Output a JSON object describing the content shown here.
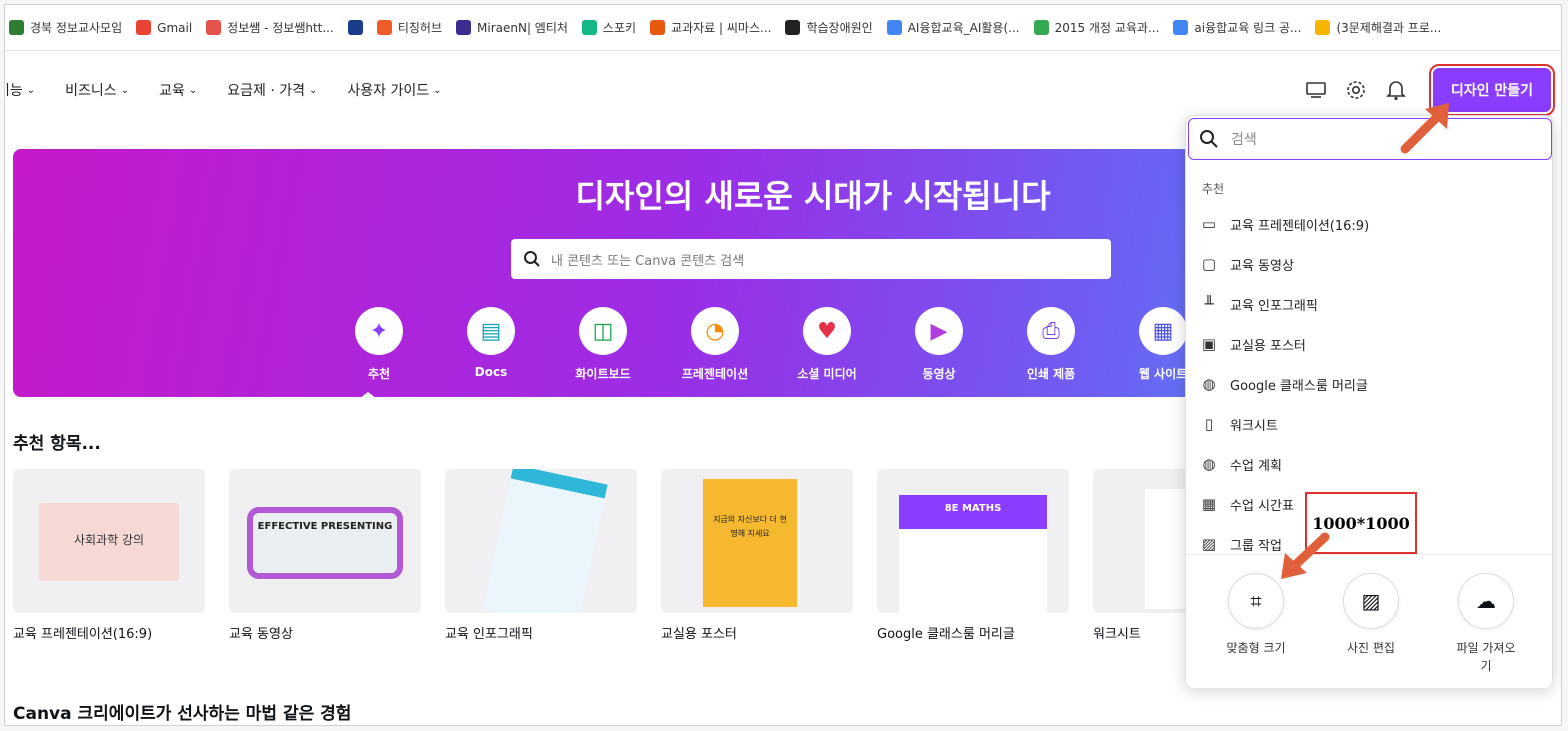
{
  "bookmarks": [
    {
      "label": "경북 정보교사모임",
      "color": "#2e7d32"
    },
    {
      "label": "Gmail",
      "color": "#ea4335"
    },
    {
      "label": "정보쌤 - 정보쌤htt...",
      "color": "#e5544b"
    },
    {
      "label": "",
      "color": "#1a3c8c"
    },
    {
      "label": "티칭허브",
      "color": "#f05a28"
    },
    {
      "label": "MiraenN| 엠티처",
      "color": "#3c2d8f"
    },
    {
      "label": "스포키",
      "color": "#12b886"
    },
    {
      "label": "교과자료 | 씨마스...",
      "color": "#e8590c"
    },
    {
      "label": "학습장애원인",
      "color": "#222222"
    },
    {
      "label": "AI융합교육_AI활용(...",
      "color": "#4285f4"
    },
    {
      "label": "2015 개정 교육과...",
      "color": "#34a853"
    },
    {
      "label": "ai융합교육 링크 공...",
      "color": "#4285f4"
    },
    {
      "label": "(3문제해결과 프로...",
      "color": "#f4b400"
    }
  ],
  "nav": {
    "items": [
      "기능",
      "비즈니스",
      "교육",
      "요금제 · 가격",
      "사용자 가이드"
    ],
    "create_label": "디자인 만들기"
  },
  "hero": {
    "title": "디자인의 새로운 시대가 시작됩니다",
    "search_placeholder": "내 콘텐츠 또는 Canva 콘텐츠 검색",
    "categories": [
      {
        "label": "추천",
        "icon": "sparkle-icon",
        "glyph": "✦",
        "color": "#8b3dff"
      },
      {
        "label": "Docs",
        "icon": "docs-icon",
        "glyph": "▤",
        "color": "#13a3b5"
      },
      {
        "label": "화이트보드",
        "icon": "whiteboard-icon",
        "glyph": "◫",
        "color": "#1aa34a"
      },
      {
        "label": "프레젠테이션",
        "icon": "presentation-icon",
        "glyph": "◔",
        "color": "#ff8a00"
      },
      {
        "label": "소셜 미디어",
        "icon": "heart-icon",
        "glyph": "♥",
        "color": "#e5304a"
      },
      {
        "label": "동영상",
        "icon": "video-icon",
        "glyph": "▶",
        "color": "#b13ae0"
      },
      {
        "label": "인쇄 제품",
        "icon": "print-icon",
        "glyph": "⎙",
        "color": "#7a3de0"
      },
      {
        "label": "웹 사이트",
        "icon": "website-icon",
        "glyph": "▦",
        "color": "#4f53e8"
      }
    ]
  },
  "recommend": {
    "title": "추천 항목...",
    "cards": [
      {
        "label": "교육 프레젠테이션(16:9)",
        "thumb_text": "사회과학 강의"
      },
      {
        "label": "교육 동영상",
        "thumb_text": "EFFECTIVE PRESENTING"
      },
      {
        "label": "교육 인포그래픽",
        "thumb_text": ""
      },
      {
        "label": "교실용 포스터",
        "thumb_text": "지금의 자신보다 더 현명해 지세요"
      },
      {
        "label": "Google 클래스룸 머리글",
        "thumb_text": "8E MATHS"
      },
      {
        "label": "워크시트",
        "thumb_text": ""
      }
    ]
  },
  "section2_title": "Canva 크리에이트가 선사하는 마법 같은 경험",
  "dropdown": {
    "search_placeholder": "검색",
    "heading": "추천",
    "items": [
      {
        "label": "교육 프레젠테이션(16:9)",
        "icon": "presentation-icon",
        "glyph": "▭"
      },
      {
        "label": "교육 동영상",
        "icon": "video-camera-icon",
        "glyph": "▢"
      },
      {
        "label": "교육 인포그래픽",
        "icon": "bar-chart-icon",
        "glyph": "╨"
      },
      {
        "label": "교실용 포스터",
        "icon": "poster-icon",
        "glyph": "▣"
      },
      {
        "label": "Google 클래스룸 머리글",
        "icon": "apple-icon",
        "glyph": "◍"
      },
      {
        "label": "워크시트",
        "icon": "document-icon",
        "glyph": "▯"
      },
      {
        "label": "수업 계획",
        "icon": "apple-icon",
        "glyph": "◍"
      },
      {
        "label": "수업 시간표",
        "icon": "calendar-icon",
        "glyph": "▦"
      },
      {
        "label": "그룹 작업",
        "icon": "image-icon",
        "glyph": "▨"
      }
    ],
    "actions": [
      {
        "label": "맞춤형 크기",
        "icon": "custom-size-icon",
        "glyph": "⌗"
      },
      {
        "label": "사진 편집",
        "icon": "photo-edit-icon",
        "glyph": "▨"
      },
      {
        "label": "파일 가져오기",
        "icon": "upload-cloud-icon",
        "glyph": "☁"
      }
    ]
  },
  "annotation": {
    "size_label": "1000*1000",
    "color": "#e03131",
    "arrow_color": "#e0603c"
  }
}
